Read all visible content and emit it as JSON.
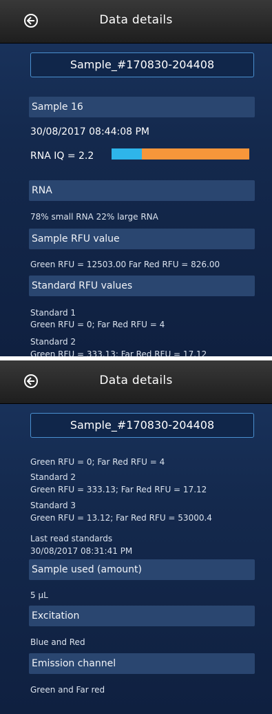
{
  "header": {
    "title": "Data details"
  },
  "sample_name": "Sample_#170830-204408",
  "screen1": {
    "sample_section": "Sample 16",
    "datetime": "30/08/2017 08:44:08 PM",
    "rna_iq": "RNA IQ = 2.2",
    "rna_iq_bar": {
      "blue_fraction": 0.22,
      "orange_fraction": 0.78,
      "colors": {
        "blue": "#2eb5ea",
        "orange": "#f7963a"
      }
    },
    "rna_section": "RNA",
    "rna_text": "78% small RNA   22% large RNA",
    "rfu_section": "Sample RFU value",
    "rfu_text": "Green RFU = 12503.00   Far Red RFU = 826.00",
    "std_section": "Standard RFU values",
    "std1_label": "Standard 1",
    "std1_values": "Green RFU = 0; Far Red RFU = 4",
    "std2_label": "Standard 2",
    "std2_values_partial": "Green RFU = 333.13; Far Red RFU = 17.12"
  },
  "screen2": {
    "std1_values": "Green RFU = 0; Far Red RFU = 4",
    "std2_label": "Standard 2",
    "std2_values": "Green RFU = 333.13; Far Red RFU = 17.12",
    "std3_label": "Standard 3",
    "std3_values": "Green RFU = 13.12; Far Red RFU = 53000.4",
    "last_read_label": "Last read standards",
    "last_read_time": "30/08/2017 08:31:41 PM",
    "sample_used_section": "Sample used (amount)",
    "sample_used_value": "5 µL",
    "excitation_section": "Excitation",
    "excitation_value": "Blue and Red",
    "emission_section": "Emission channel",
    "emission_value": "Green and Far red"
  }
}
